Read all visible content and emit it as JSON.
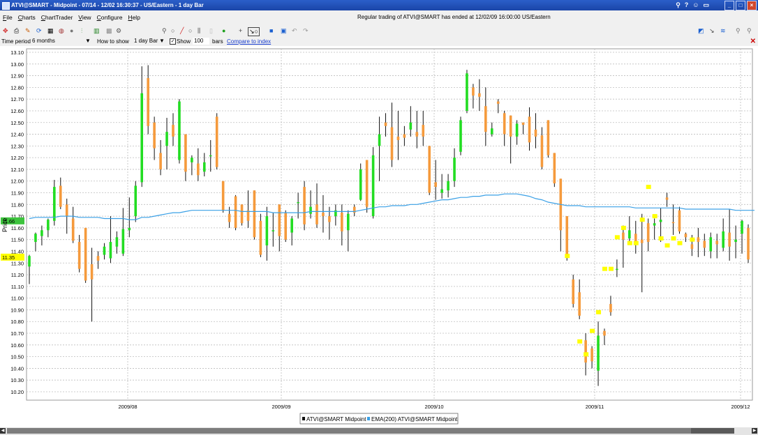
{
  "window": {
    "title": "ATVI@SMART - Midpoint - 07/14 - 12/02 16:30:37 - US/Eastern - 1 day Bar",
    "title_icons": [
      "pin-icon",
      "help-icon",
      "users-icon",
      "screen-icon"
    ],
    "controls": [
      "minimize",
      "maximize",
      "close"
    ]
  },
  "menu": {
    "items": [
      "File",
      "Charts",
      "ChartTrader",
      "View",
      "Configure",
      "Help"
    ],
    "status": "Regular trading of ATVI@SMART has ended at 12/02/09 16:00:00 US/Eastern"
  },
  "toolbar": {
    "left_icons": [
      "crosshair-icon",
      "print-icon",
      "pencil-icon",
      "refresh-icon",
      "grid-icon",
      "palette-icon",
      "record-icon",
      "bars-icon",
      "candles-icon",
      "chart-icon",
      "gear-icon"
    ],
    "mid_icons": [
      "zoom-icon",
      "circle-icon",
      "line-icon",
      "circle2-icon",
      "histogram-icon",
      "blank-icon",
      "go-icon",
      "plus-icon",
      "trend-icon",
      "settings-icon",
      "square-icon",
      "color-icon",
      "undo-icon",
      "redo-icon"
    ],
    "right_icons": [
      "indicator-icon",
      "draw-icon",
      "fib-icon",
      "zoom-in-icon",
      "zoom-out-icon",
      "expand-icon"
    ]
  },
  "params": {
    "time_period_label": "Time period",
    "time_period_value": "6 months",
    "how_to_show_label": "How to show",
    "how_to_show_value": "1 day Bar",
    "show_label": "Show",
    "show_value": "100",
    "bars_label": "bars",
    "compare_link": "Compare to index"
  },
  "chart": {
    "y_axis_label": "Price",
    "y_ticks": [
      "13.10",
      "13.00",
      "12.90",
      "12.80",
      "12.70",
      "12.60",
      "12.50",
      "12.40",
      "12.30",
      "12.20",
      "12.10",
      "12.00",
      "11.90",
      "11.80",
      "11.70",
      "11.60",
      "11.50",
      "11.40",
      "11.30",
      "11.20",
      "11.10",
      "11.00",
      "10.90",
      "10.80",
      "10.70",
      "10.60",
      "10.50",
      "10.40",
      "10.30",
      "10.20"
    ],
    "x_ticks": [
      "2009/08",
      "2009/09",
      "2009/10",
      "2009/11",
      "2009/12"
    ],
    "price_tags": [
      {
        "label": "11.66",
        "color": "#3ec43e"
      },
      {
        "label": "11.35",
        "color": "#ffff00"
      }
    ],
    "legend": [
      "ATVI@SMART Midpoint",
      "EMA(200) ATVI@SMART Midpoint"
    ],
    "colors": {
      "up": "#22dd22",
      "down": "#f59a3c",
      "ema": "#3aa0e6",
      "marker": "#ffff00"
    }
  },
  "chart_data": {
    "type": "ohlc-bar",
    "title": "ATVI@SMART Midpoint",
    "ylabel": "Price",
    "ylim": [
      10.15,
      13.12
    ],
    "xlabels": [
      "2009/08",
      "2009/09",
      "2009/10",
      "2009/11",
      "2009/12"
    ],
    "series": [
      {
        "name": "ATVI@SMART Midpoint",
        "bars": [
          [
            11.27,
            11.37,
            11.12,
            11.36
          ],
          [
            11.48,
            11.56,
            11.4,
            11.55
          ],
          [
            11.53,
            11.62,
            11.45,
            11.58
          ],
          [
            11.58,
            11.68,
            11.52,
            11.67
          ],
          [
            11.66,
            12.01,
            11.62,
            11.95
          ],
          [
            11.96,
            12.03,
            11.76,
            11.78
          ],
          [
            11.8,
            11.85,
            11.55,
            11.7
          ],
          [
            11.68,
            11.78,
            11.47,
            11.49
          ],
          [
            11.48,
            11.54,
            11.22,
            11.25
          ],
          [
            11.6,
            11.6,
            11.13,
            11.15
          ],
          [
            11.29,
            11.43,
            10.8,
            11.16
          ],
          [
            11.36,
            11.4,
            11.25,
            11.32
          ],
          [
            11.37,
            11.47,
            11.33,
            11.44
          ],
          [
            11.34,
            11.7,
            11.3,
            11.48
          ],
          [
            11.44,
            11.57,
            11.38,
            11.52
          ],
          [
            11.38,
            11.77,
            11.36,
            11.59
          ],
          [
            11.58,
            11.86,
            11.52,
            11.6
          ],
          [
            11.7,
            12.0,
            11.65,
            11.96
          ],
          [
            11.99,
            12.98,
            11.95,
            12.75
          ],
          [
            12.88,
            12.99,
            12.4,
            12.47
          ],
          [
            12.5,
            12.55,
            12.18,
            12.28
          ],
          [
            12.24,
            12.35,
            12.05,
            12.1
          ],
          [
            12.3,
            12.54,
            12.1,
            12.42
          ],
          [
            12.48,
            12.58,
            12.3,
            12.38
          ],
          [
            12.18,
            12.7,
            12.15,
            12.68
          ],
          [
            12.4,
            12.4,
            12.0,
            12.08
          ],
          [
            12.16,
            12.22,
            12.05,
            12.2
          ],
          [
            12.15,
            12.28,
            12.0,
            12.05
          ],
          [
            12.08,
            12.24,
            12.04,
            12.16
          ],
          [
            12.22,
            12.35,
            12.08,
            12.22
          ],
          [
            12.55,
            12.58,
            12.1,
            12.12
          ],
          [
            12.0,
            12.0,
            11.73,
            11.75
          ],
          [
            11.72,
            11.78,
            11.6,
            11.65
          ],
          [
            11.87,
            11.88,
            11.58,
            11.6
          ],
          [
            11.8,
            11.8,
            11.62,
            11.64
          ],
          [
            11.75,
            11.92,
            11.6,
            11.66
          ],
          [
            11.92,
            11.92,
            11.5,
            11.52
          ],
          [
            11.66,
            11.72,
            11.35,
            11.37
          ],
          [
            11.45,
            11.78,
            11.32,
            11.7
          ],
          [
            11.57,
            11.73,
            11.44,
            11.58
          ],
          [
            11.8,
            11.8,
            11.4,
            11.53
          ],
          [
            11.73,
            11.75,
            11.48,
            11.5
          ],
          [
            11.56,
            11.7,
            11.45,
            11.68
          ],
          [
            11.82,
            11.9,
            11.68,
            11.82
          ],
          [
            11.95,
            12.0,
            11.58,
            11.63
          ],
          [
            11.72,
            11.92,
            11.68,
            11.78
          ],
          [
            11.8,
            11.98,
            11.6,
            11.63
          ],
          [
            11.73,
            11.88,
            11.56,
            11.7
          ],
          [
            11.7,
            11.78,
            11.5,
            11.65
          ],
          [
            11.7,
            11.8,
            11.62,
            11.75
          ],
          [
            11.73,
            11.8,
            11.45,
            11.57
          ],
          [
            11.58,
            11.75,
            11.4,
            11.72
          ],
          [
            11.78,
            11.8,
            11.7,
            11.73
          ],
          [
            11.84,
            12.15,
            11.83,
            12.1
          ],
          [
            12.18,
            12.18,
            11.73,
            11.78
          ],
          [
            11.7,
            12.29,
            11.68,
            12.22
          ],
          [
            12.3,
            12.55,
            12.0,
            12.4
          ],
          [
            12.5,
            12.58,
            12.38,
            12.47
          ],
          [
            12.46,
            12.67,
            12.12,
            12.18
          ],
          [
            12.38,
            12.6,
            12.18,
            12.35
          ],
          [
            12.4,
            12.47,
            12.3,
            12.37
          ],
          [
            12.44,
            12.64,
            12.38,
            12.5
          ],
          [
            12.42,
            12.6,
            12.28,
            12.38
          ],
          [
            12.48,
            12.6,
            12.3,
            12.38
          ],
          [
            12.3,
            12.3,
            11.88,
            11.9
          ],
          [
            11.99,
            12.18,
            11.84,
            11.95
          ],
          [
            11.9,
            12.06,
            11.85,
            11.93
          ],
          [
            11.92,
            12.06,
            11.86,
            12.0
          ],
          [
            12.0,
            12.28,
            11.95,
            12.2
          ],
          [
            12.25,
            12.55,
            12.22,
            12.52
          ],
          [
            12.6,
            12.95,
            12.58,
            12.92
          ],
          [
            12.8,
            12.83,
            12.62,
            12.73
          ],
          [
            12.75,
            12.87,
            12.6,
            12.72
          ],
          [
            12.64,
            12.8,
            12.3,
            12.42
          ],
          [
            12.4,
            12.5,
            12.38,
            12.45
          ],
          [
            12.68,
            12.7,
            12.58,
            12.66
          ],
          [
            12.58,
            12.6,
            12.3,
            12.4
          ],
          [
            12.56,
            12.56,
            12.15,
            12.38
          ],
          [
            12.38,
            12.52,
            12.31,
            12.49
          ],
          [
            12.5,
            12.5,
            12.4,
            12.48
          ],
          [
            12.55,
            12.63,
            12.26,
            12.33
          ],
          [
            12.44,
            12.58,
            12.28,
            12.38
          ],
          [
            12.39,
            12.46,
            12.1,
            12.12
          ],
          [
            12.52,
            12.52,
            12.2,
            12.22
          ],
          [
            12.24,
            12.24,
            11.95,
            11.98
          ],
          [
            12.02,
            12.02,
            11.4,
            11.58
          ],
          [
            11.7,
            11.7,
            11.32,
            11.35
          ],
          [
            11.16,
            11.2,
            10.92,
            10.95
          ],
          [
            11.05,
            11.16,
            10.82,
            10.85
          ],
          [
            10.64,
            10.7,
            10.34,
            10.45
          ],
          [
            10.57,
            10.59,
            10.4,
            10.46
          ],
          [
            10.38,
            10.8,
            10.25,
            10.68
          ],
          [
            10.72,
            10.74,
            10.6,
            10.68
          ],
          [
            10.95,
            11.02,
            10.85,
            10.88
          ],
          [
            11.25,
            11.33,
            11.18,
            11.25
          ],
          [
            11.56,
            11.62,
            11.26,
            11.5
          ],
          [
            11.51,
            11.7,
            11.48,
            11.58
          ],
          [
            11.55,
            11.66,
            11.38,
            11.46
          ],
          [
            11.5,
            11.72,
            11.05,
            11.47
          ],
          [
            11.64,
            11.68,
            11.4,
            11.48
          ],
          [
            11.62,
            11.68,
            11.5,
            11.64
          ],
          [
            11.65,
            11.77,
            11.48,
            11.67
          ],
          [
            11.86,
            11.9,
            11.78,
            11.84
          ],
          [
            11.65,
            11.8,
            11.54,
            11.64
          ],
          [
            11.75,
            11.78,
            11.55,
            11.57
          ],
          [
            11.55,
            11.56,
            11.48,
            11.52
          ],
          [
            11.46,
            11.54,
            11.36,
            11.42
          ],
          [
            11.52,
            11.6,
            11.35,
            11.48
          ],
          [
            11.49,
            11.55,
            11.36,
            11.43
          ],
          [
            11.4,
            11.56,
            11.34,
            11.52
          ],
          [
            11.49,
            11.55,
            11.34,
            11.46
          ],
          [
            11.43,
            11.68,
            11.4,
            11.57
          ],
          [
            11.56,
            11.76,
            11.32,
            11.44
          ],
          [
            11.48,
            11.62,
            11.34,
            11.5
          ],
          [
            11.55,
            11.67,
            11.38,
            11.66
          ],
          [
            11.6,
            11.63,
            11.3,
            11.33
          ]
        ]
      },
      {
        "name": "EMA(200) ATVI@SMART Midpoint",
        "values": [
          11.68,
          11.69,
          11.69,
          11.69,
          11.69,
          11.7,
          11.7,
          11.7,
          11.69,
          11.69,
          11.69,
          11.69,
          11.68,
          11.68,
          11.68,
          11.68,
          11.67,
          11.67,
          11.69,
          11.69,
          11.7,
          11.71,
          11.72,
          11.73,
          11.73,
          11.74,
          11.75,
          11.75,
          11.75,
          11.75,
          11.75,
          11.75,
          11.75,
          11.75,
          11.74,
          11.74,
          11.74,
          11.74,
          11.74,
          11.73,
          11.73,
          11.73,
          11.73,
          11.73,
          11.73,
          11.74,
          11.74,
          11.74,
          11.74,
          11.74,
          11.74,
          11.74,
          11.74,
          11.75,
          11.76,
          11.77,
          11.78,
          11.78,
          11.79,
          11.79,
          11.79,
          11.8,
          11.8,
          11.81,
          11.82,
          11.83,
          11.84,
          11.84,
          11.85,
          11.86,
          11.86,
          11.87,
          11.87,
          11.88,
          11.88,
          11.88,
          11.89,
          11.89,
          11.89,
          11.88,
          11.87,
          11.85,
          11.84,
          11.82,
          11.81,
          11.8,
          11.79,
          11.79,
          11.79,
          11.78,
          11.78,
          11.78,
          11.78,
          11.78,
          11.78,
          11.78,
          11.78,
          11.77,
          11.77,
          11.77,
          11.77,
          11.77,
          11.77,
          11.77,
          11.77,
          11.76,
          11.76,
          11.76,
          11.76,
          11.76,
          11.76,
          11.76,
          11.76,
          11.75,
          11.75,
          11.75,
          11.75
        ]
      }
    ],
    "markers": [
      [
        86,
        11.36
      ],
      [
        88,
        10.63
      ],
      [
        89,
        10.52
      ],
      [
        90,
        10.72
      ],
      [
        91,
        10.88
      ],
      [
        92,
        11.25
      ],
      [
        93,
        11.25
      ],
      [
        94,
        11.52
      ],
      [
        95,
        11.6
      ],
      [
        96,
        11.47
      ],
      [
        97,
        11.47
      ],
      [
        98,
        11.67
      ],
      [
        99,
        11.95
      ],
      [
        100,
        11.7
      ],
      [
        101,
        11.51
      ],
      [
        102,
        11.45
      ],
      [
        103,
        11.51
      ],
      [
        104,
        11.47
      ],
      [
        106,
        11.5
      ]
    ]
  }
}
